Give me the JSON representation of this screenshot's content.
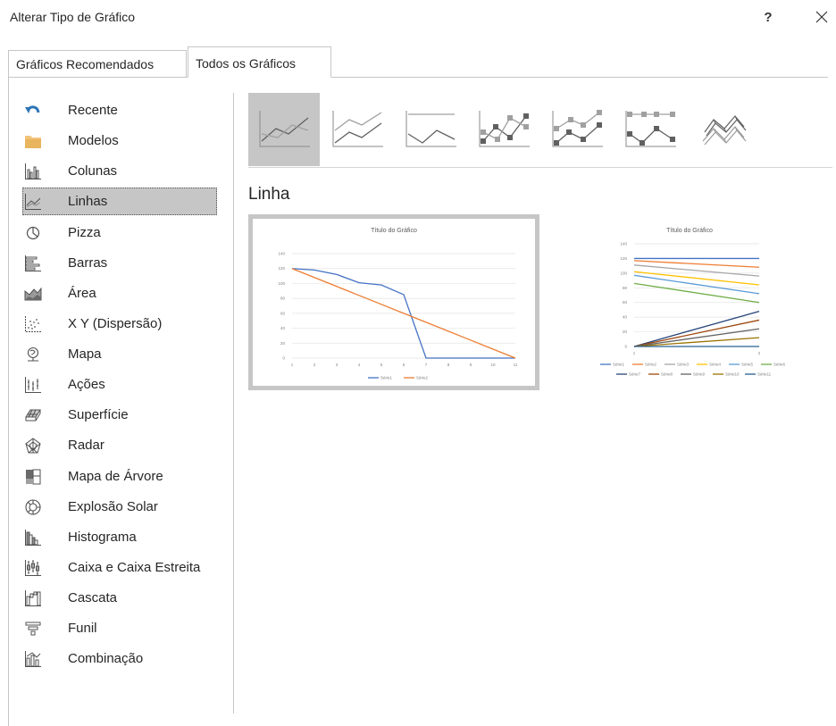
{
  "dialog": {
    "title": "Alterar Tipo de Gráfico",
    "help": "?",
    "close_icon": "close-icon"
  },
  "tabs": [
    {
      "label": "Gráficos Recomendados",
      "active": false
    },
    {
      "label": "Todos os Gráficos",
      "active": true
    }
  ],
  "sidebar": {
    "items": [
      {
        "label": "Recente",
        "icon": "recent-icon"
      },
      {
        "label": "Modelos",
        "icon": "folder-icon"
      },
      {
        "label": "Colunas",
        "icon": "column-chart-icon"
      },
      {
        "label": "Linhas",
        "icon": "line-chart-icon",
        "selected": true
      },
      {
        "label": "Pizza",
        "icon": "pie-chart-icon"
      },
      {
        "label": "Barras",
        "icon": "bar-chart-icon"
      },
      {
        "label": "Área",
        "icon": "area-chart-icon"
      },
      {
        "label": "X Y (Dispersão)",
        "icon": "scatter-chart-icon"
      },
      {
        "label": "Mapa",
        "icon": "map-chart-icon"
      },
      {
        "label": "Ações",
        "icon": "stock-chart-icon"
      },
      {
        "label": "Superfície",
        "icon": "surface-chart-icon"
      },
      {
        "label": "Radar",
        "icon": "radar-chart-icon"
      },
      {
        "label": "Mapa de Árvore",
        "icon": "treemap-chart-icon"
      },
      {
        "label": "Explosão Solar",
        "icon": "sunburst-chart-icon"
      },
      {
        "label": "Histograma",
        "icon": "histogram-chart-icon"
      },
      {
        "label": "Caixa e Caixa Estreita",
        "icon": "box-whisker-chart-icon"
      },
      {
        "label": "Cascata",
        "icon": "waterfall-chart-icon"
      },
      {
        "label": "Funil",
        "icon": "funnel-chart-icon"
      },
      {
        "label": "Combinação",
        "icon": "combo-chart-icon"
      }
    ]
  },
  "subtypes": [
    {
      "icon": "line-subtype-icon",
      "selected": true
    },
    {
      "icon": "stacked-line-subtype-icon"
    },
    {
      "icon": "100-stacked-line-subtype-icon"
    },
    {
      "icon": "line-with-markers-subtype-icon"
    },
    {
      "icon": "stacked-line-with-markers-subtype-icon"
    },
    {
      "icon": "100-stacked-line-with-markers-subtype-icon"
    },
    {
      "icon": "3d-line-subtype-icon"
    }
  ],
  "section_title": "Linha",
  "colors": {
    "blue": "#4472c4",
    "orange": "#ed7d31",
    "gray": "#a5a5a5",
    "gold": "#ffc000",
    "lightblue": "#5b9bd5",
    "green": "#70ad47",
    "darkblue": "#264478",
    "brown": "#9e480e",
    "darkgray": "#636363",
    "olive": "#997300",
    "steel": "#255e91",
    "selection": "#c6c6c6"
  },
  "previews": [
    {
      "title": "Título do Gráfico",
      "chart_data": {
        "type": "line",
        "title": "Título do Gráfico",
        "x": [
          1,
          2,
          3,
          4,
          5,
          6,
          7,
          8,
          9,
          10,
          11
        ],
        "ylim": [
          0,
          140
        ],
        "yticks": [
          0,
          20,
          40,
          60,
          80,
          100,
          120,
          140
        ],
        "series": [
          {
            "name": "Série1",
            "color": "#4472c4",
            "values": [
              120,
              118,
              112,
              101,
              98,
              85,
              0,
              0,
              0,
              0,
              0
            ]
          },
          {
            "name": "Série2",
            "color": "#ed7d31",
            "values": [
              120,
              108,
              96,
              84,
              72,
              60,
              48,
              36,
              24,
              12,
              0
            ]
          }
        ],
        "legend": "bottom"
      }
    },
    {
      "title": "Título do Gráfico",
      "chart_data": {
        "type": "line",
        "title": "Título do Gráfico",
        "x": [
          1,
          2
        ],
        "ylim": [
          0,
          140
        ],
        "yticks": [
          0,
          20,
          40,
          60,
          80,
          100,
          120,
          140
        ],
        "series": [
          {
            "name": "Série1",
            "color": "#4472c4",
            "values": [
              120,
              120
            ]
          },
          {
            "name": "Série2",
            "color": "#ed7d31",
            "values": [
              117,
              108
            ]
          },
          {
            "name": "Série3",
            "color": "#a5a5a5",
            "values": [
              111,
              96
            ]
          },
          {
            "name": "Série4",
            "color": "#ffc000",
            "values": [
              102,
              84
            ]
          },
          {
            "name": "Série5",
            "color": "#5b9bd5",
            "values": [
              97,
              72
            ]
          },
          {
            "name": "Série6",
            "color": "#70ad47",
            "values": [
              86,
              60
            ]
          },
          {
            "name": "Série7",
            "color": "#264478",
            "values": [
              0,
              48
            ]
          },
          {
            "name": "Série8",
            "color": "#9e480e",
            "values": [
              0,
              36
            ]
          },
          {
            "name": "Série9",
            "color": "#636363",
            "values": [
              0,
              24
            ]
          },
          {
            "name": "Série10",
            "color": "#997300",
            "values": [
              0,
              12
            ]
          },
          {
            "name": "Série11",
            "color": "#255e91",
            "values": [
              0,
              0
            ]
          }
        ],
        "legend": "bottom"
      }
    }
  ]
}
